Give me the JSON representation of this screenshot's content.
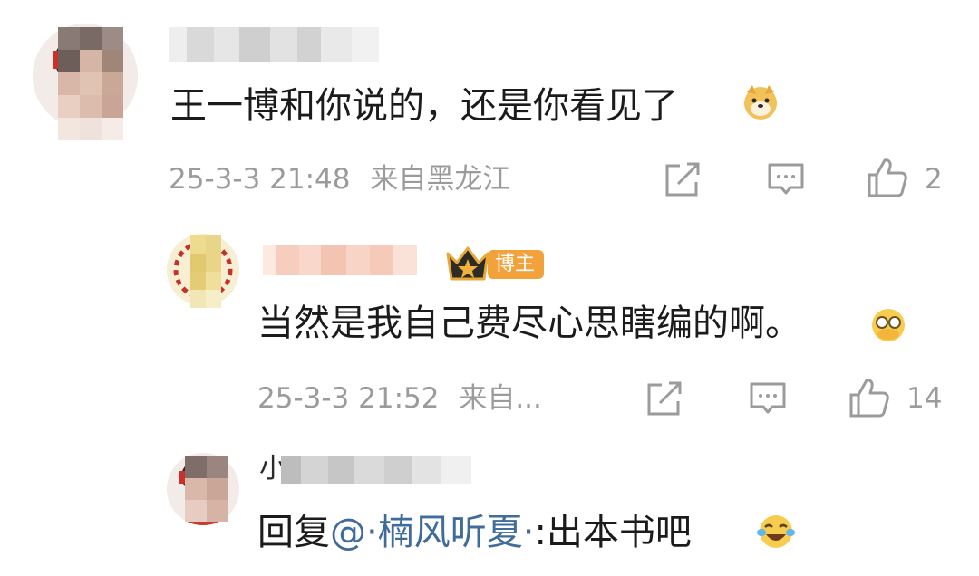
{
  "comments": [
    {
      "text": "王一博和你说的，还是你看见了",
      "emoji": "doge-emoji",
      "timestamp": "25-3-3 21:48",
      "location": "来自黑龙江",
      "like_count": "2"
    },
    {
      "badge": "博主",
      "text": "当然是我自己费尽心思瞎编的啊。",
      "emoji": "facepalm-emoji",
      "timestamp": "25-3-3 21:52",
      "location": "来自...",
      "like_count": "14"
    },
    {
      "name_visible_char": "小",
      "reply_prefix": "回复",
      "mention": "@·楠风听夏·",
      "reply_text": ":出本书吧",
      "emoji": "laughing-tears-emoji"
    }
  ],
  "colors": {
    "meta_gray": "#9b9b9b",
    "mention_blue": "#3f6c9b",
    "badge_orange": "#f2a23a"
  }
}
